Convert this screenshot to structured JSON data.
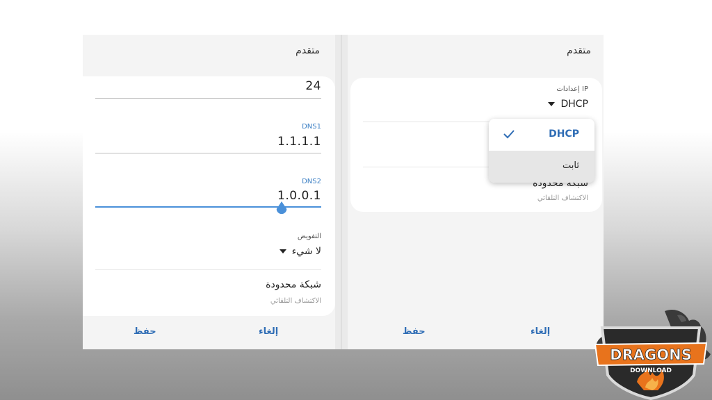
{
  "left_panel": {
    "title": "متقدم",
    "prefix_value": "24",
    "dns1_label": "DNS1",
    "dns1_value": "1.1.1.1",
    "dns2_label": "DNS2",
    "dns2_value": "1.0.0.1",
    "delegation_label": "التفويض",
    "delegation_value": "لا شيء",
    "metered_title": "شبكة محدودة",
    "metered_sub": "الاكتشاف التلقائي",
    "cancel_label": "إلغاء",
    "save_label": "حفظ"
  },
  "right_panel": {
    "title": "متقدم",
    "ip_settings_label": "إعدادات IP",
    "ip_settings_value": "DHCP",
    "metered_title": "شبكة محدودة",
    "metered_sub": "الاكتشاف التلقائي",
    "cancel_label": "إلغاء",
    "save_label": "حفظ",
    "dropdown_options": [
      "DHCP",
      "ثابت"
    ],
    "selected_option": "DHCP"
  },
  "logo": {
    "text_main": "DRAGONS",
    "text_sub": "DOWNLOAD"
  },
  "colors": {
    "accent": "#2f6db5",
    "label_blue": "#3b7fc4",
    "logo_orange": "#e8731c"
  }
}
